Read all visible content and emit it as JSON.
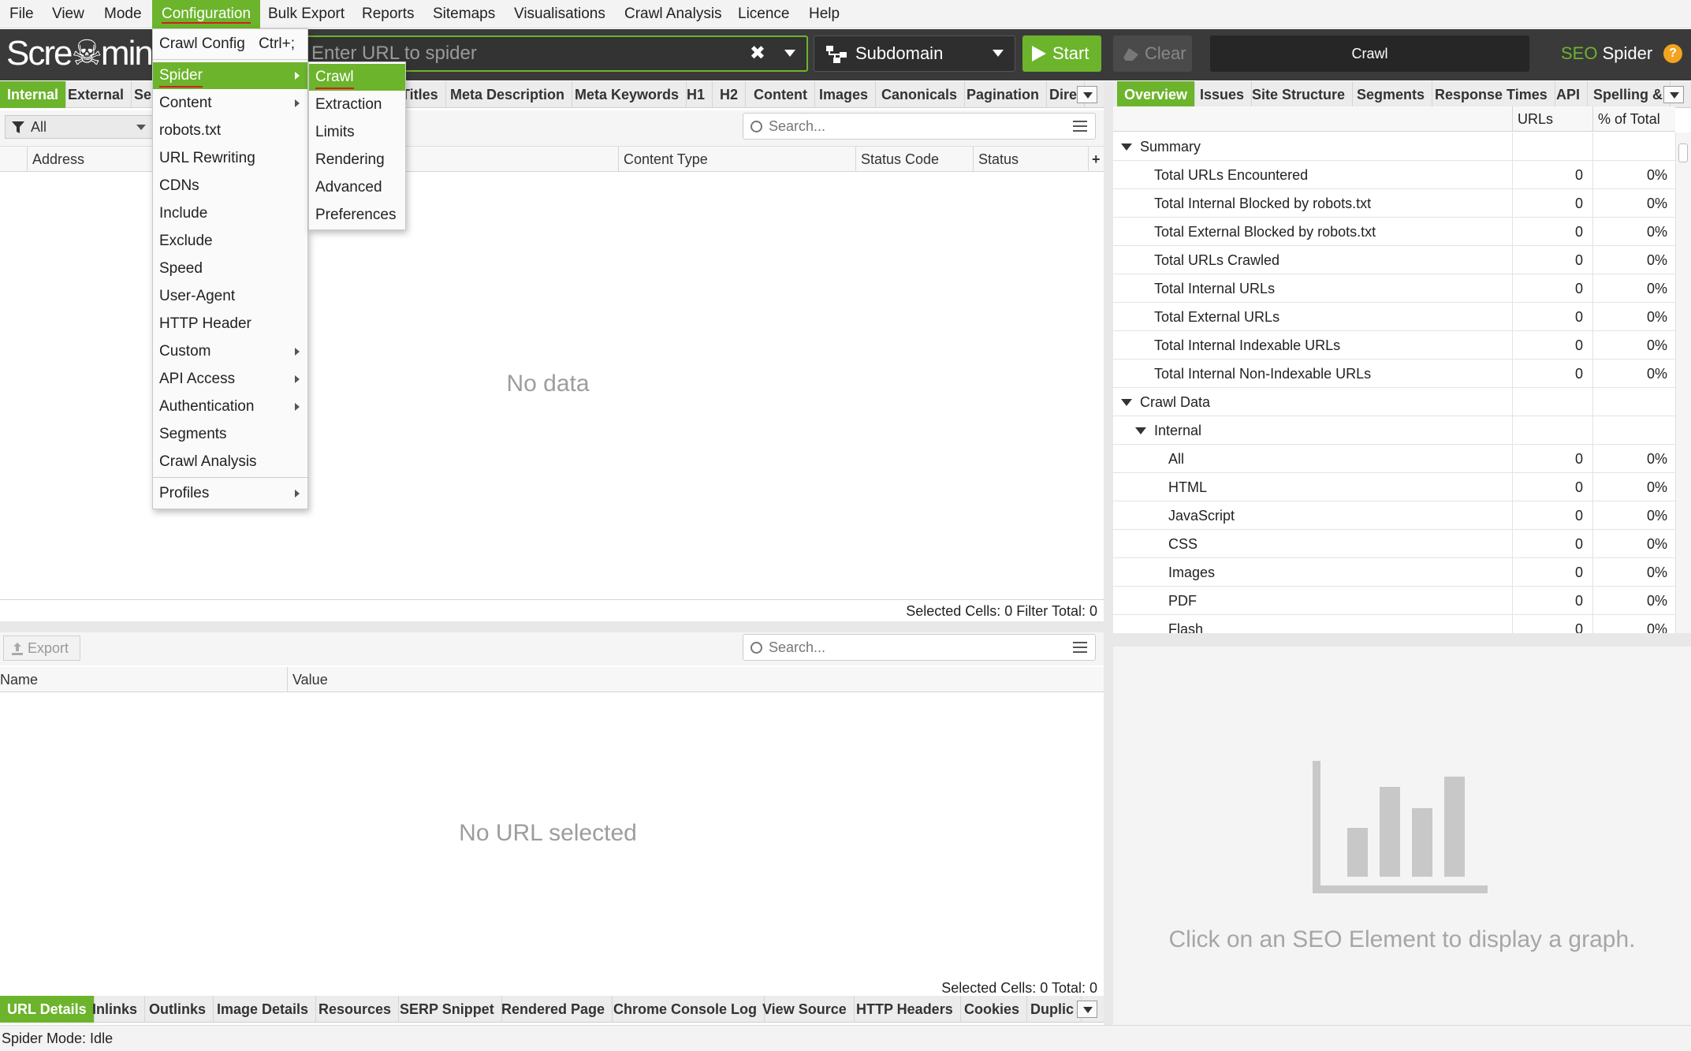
{
  "menubar": [
    "File",
    "View",
    "Mode",
    "Configuration",
    "Bulk Export",
    "Reports",
    "Sitemaps",
    "Visualisations",
    "Crawl Analysis",
    "Licence",
    "Help"
  ],
  "toolbar": {
    "logo": "Scre☠min",
    "url_placeholder": "Enter URL to spider",
    "clear_x": "✖",
    "mode": "Subdomain",
    "start": "Start",
    "clear": "Clear",
    "crawl_label": "Crawl",
    "brand_seo": "SEO",
    "brand_spider": " Spider",
    "help_badge": "?"
  },
  "main_tabs": [
    "Internal",
    "External",
    "Se",
    "Titles",
    "Meta Description",
    "Meta Keywords",
    "H1",
    "H2",
    "Content",
    "Images",
    "Canonicals",
    "Pagination",
    "Dire"
  ],
  "filter": {
    "selected": "All",
    "search_placeholder": "Search..."
  },
  "main_columns": [
    "Address",
    "Content Type",
    "Status Code",
    "Status"
  ],
  "main_empty": "No data",
  "main_status": "Selected Cells:  0  Filter Total:  0",
  "detail": {
    "export": "Export",
    "search_placeholder": "Search...",
    "columns": [
      "Name",
      "Value"
    ],
    "empty": "No URL selected",
    "status": "Selected Cells:  0  Total:  0"
  },
  "bottom_tabs": [
    "URL Details",
    "Inlinks",
    "Outlinks",
    "Image Details",
    "Resources",
    "SERP Snippet",
    "Rendered Page",
    "Chrome Console Log",
    "View Source",
    "HTTP Headers",
    "Cookies",
    "Duplic"
  ],
  "right_tabs": [
    "Overview",
    "Issues",
    "Site Structure",
    "Segments",
    "Response Times",
    "API",
    "Spelling &"
  ],
  "overview": {
    "headers": [
      "URLs",
      "% of Total"
    ],
    "rows": [
      {
        "label": "Summary",
        "urls": "",
        "pct": ""
      },
      {
        "label": "Total URLs Encountered",
        "urls": "0",
        "pct": "0%"
      },
      {
        "label": "Total Internal Blocked by robots.txt",
        "urls": "0",
        "pct": "0%"
      },
      {
        "label": "Total External Blocked by robots.txt",
        "urls": "0",
        "pct": "0%"
      },
      {
        "label": "Total URLs Crawled",
        "urls": "0",
        "pct": "0%"
      },
      {
        "label": "Total Internal URLs",
        "urls": "0",
        "pct": "0%"
      },
      {
        "label": "Total External URLs",
        "urls": "0",
        "pct": "0%"
      },
      {
        "label": "Total Internal Indexable URLs",
        "urls": "0",
        "pct": "0%"
      },
      {
        "label": "Total Internal Non-Indexable URLs",
        "urls": "0",
        "pct": "0%"
      },
      {
        "label": "Crawl Data",
        "urls": "",
        "pct": ""
      },
      {
        "label": "Internal",
        "urls": "",
        "pct": ""
      },
      {
        "label": "All",
        "urls": "0",
        "pct": "0%"
      },
      {
        "label": "HTML",
        "urls": "0",
        "pct": "0%"
      },
      {
        "label": "JavaScript",
        "urls": "0",
        "pct": "0%"
      },
      {
        "label": "CSS",
        "urls": "0",
        "pct": "0%"
      },
      {
        "label": "Images",
        "urls": "0",
        "pct": "0%"
      },
      {
        "label": "PDF",
        "urls": "0",
        "pct": "0%"
      },
      {
        "label": "Flash",
        "urls": "0",
        "pct": "0%"
      }
    ]
  },
  "graph_message": "Click on an SEO Element to display a graph.",
  "status_bar": "Spider Mode: Idle",
  "config_menu": {
    "items": [
      {
        "label": "Crawl Config",
        "shortcut": "Ctrl+;"
      },
      {
        "label": "Spider"
      },
      {
        "label": "Content"
      },
      {
        "label": "robots.txt"
      },
      {
        "label": "URL Rewriting"
      },
      {
        "label": "CDNs"
      },
      {
        "label": "Include"
      },
      {
        "label": "Exclude"
      },
      {
        "label": "Speed"
      },
      {
        "label": "User-Agent"
      },
      {
        "label": "HTTP Header"
      },
      {
        "label": "Custom"
      },
      {
        "label": "API Access"
      },
      {
        "label": "Authentication"
      },
      {
        "label": "Segments"
      },
      {
        "label": "Crawl Analysis"
      },
      {
        "label": "Profiles"
      }
    ]
  },
  "spider_submenu": [
    "Crawl",
    "Extraction",
    "Limits",
    "Rendering",
    "Advanced",
    "Preferences"
  ],
  "colors": {
    "accent": "#6cb42c",
    "dark": "#3a3a3a",
    "underline": "#d21f1f",
    "warning": "#f3a31f"
  }
}
